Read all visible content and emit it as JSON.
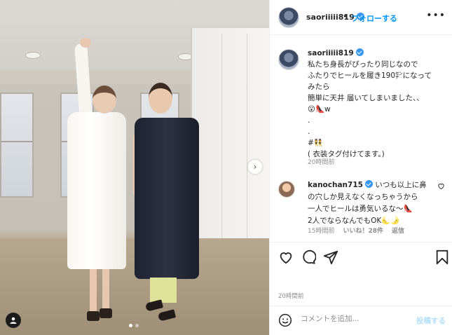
{
  "header": {
    "username": "saoriiiii819",
    "bullet": "•",
    "follow_label": "フォローする",
    "more_label": "•••"
  },
  "caption": {
    "username": "saoriiiii819",
    "text": "私たち身長がぴったり同じなので\nふたりでヒールを履き190㌢になって\nみたら\n簡単に天井 届いてしまいました、、\n😮👠w\n.\n.\n#👯\n( 衣装タグ付けてます。)",
    "time": "20時間前"
  },
  "comment": {
    "username": "kanochan715",
    "text": "いつも以上に鼻\nの穴しか見えなくなっちゃうから\n一人でヒールは勇気いるな〜👠\n2人でならなんでもOK🌜🌛",
    "time": "15時間前",
    "likes": "いいね！28件",
    "reply": "返信"
  },
  "actions": {
    "like": "heart-icon",
    "comment": "comment-icon",
    "share": "share-icon",
    "save": "bookmark-icon"
  },
  "post_time": "20時間前",
  "comment_input": {
    "placeholder": "コメントを追加...",
    "post_label": "投稿する"
  },
  "carousel": {
    "current_index": 1,
    "count": 2
  },
  "colors": {
    "accent": "#0095f6",
    "verified": "#3897f0",
    "post_disabled": "#b2dffc"
  }
}
